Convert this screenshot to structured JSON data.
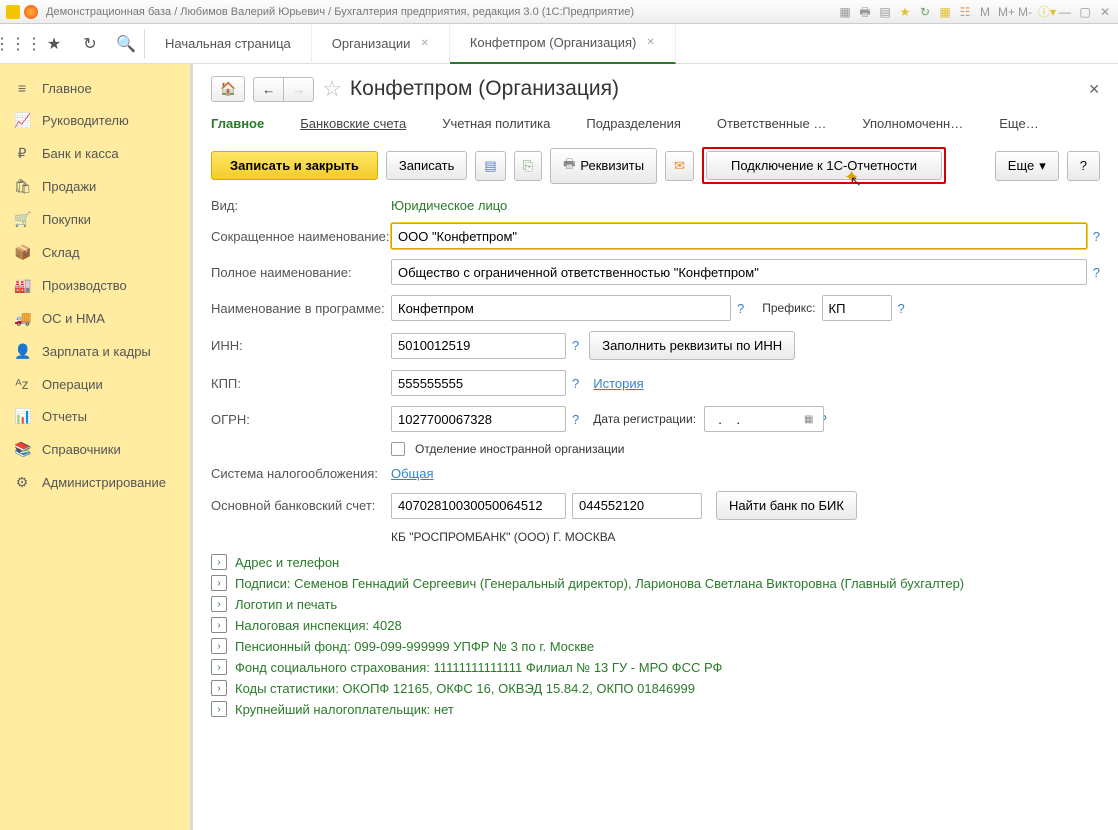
{
  "window": {
    "title": "Демонстрационная база / Любимов Валерий Юрьевич / Бухгалтерия предприятия, редакция 3.0  (1С:Предприятие)"
  },
  "tabs": [
    {
      "label": "Начальная страница",
      "closable": false,
      "active": false
    },
    {
      "label": "Организации",
      "closable": true,
      "active": false
    },
    {
      "label": "Конфетпром (Организация)",
      "closable": true,
      "active": true
    }
  ],
  "sidebar": [
    {
      "icon": "≡",
      "label": "Главное"
    },
    {
      "icon": "📈",
      "label": "Руководителю"
    },
    {
      "icon": "₽",
      "label": "Банк и касса"
    },
    {
      "icon": "🛍",
      "label": "Продажи"
    },
    {
      "icon": "🛒",
      "label": "Покупки"
    },
    {
      "icon": "📦",
      "label": "Склад"
    },
    {
      "icon": "🏭",
      "label": "Производство"
    },
    {
      "icon": "🚚",
      "label": "ОС и НМА"
    },
    {
      "icon": "👤",
      "label": "Зарплата и кадры"
    },
    {
      "icon": "ᴬz",
      "label": "Операции"
    },
    {
      "icon": "📊",
      "label": "Отчеты"
    },
    {
      "icon": "📚",
      "label": "Справочники"
    },
    {
      "icon": "⚙",
      "label": "Администрирование"
    }
  ],
  "page": {
    "title": "Конфетпром (Организация)",
    "subtabs": [
      "Главное",
      "Банковские счета",
      "Учетная политика",
      "Подразделения",
      "Ответственные …",
      "Уполномоченн…",
      "Еще…"
    ]
  },
  "buttons": {
    "save_close": "Записать и закрыть",
    "save": "Записать",
    "requisites": "Реквизиты",
    "connect1c": "Подключение к 1С-Отчетности",
    "more": "Еще",
    "help": "?",
    "fill_inn": "Заполнить реквизиты по ИНН",
    "history": "История",
    "find_bank": "Найти банк по БИК"
  },
  "labels": {
    "type": "Вид:",
    "short_name": "Сокращенное наименование:",
    "full_name": "Полное наименование:",
    "prog_name": "Наименование в программе:",
    "prefix": "Префикс:",
    "inn": "ИНН:",
    "kpp": "КПП:",
    "ogrn": "ОГРН:",
    "reg_date": "Дата регистрации:",
    "foreign": "Отделение иностранной организации",
    "tax_system": "Система налогообложения:",
    "bank_acc": "Основной банковский счет:"
  },
  "values": {
    "type": "Юридическое лицо",
    "short_name": "ООО \"Конфетпром\"",
    "full_name": "Общество с ограниченной ответственностью \"Конфетпром\"",
    "prog_name": "Конфетпром",
    "prefix": "КП",
    "inn": "5010012519",
    "kpp": "555555555",
    "ogrn": "1027700067328",
    "reg_date": "  .    .",
    "tax_system": "Общая",
    "bank_acc": "40702810030050064512",
    "bik": "044552120",
    "bank_name": "КБ \"РОСПРОМБАНК\" (ООО) Г. МОСКВА"
  },
  "expandables": [
    "Адрес и телефон",
    "Подписи: Семенов Геннадий Сергеевич (Генеральный директор), Ларионова Светлана Викторовна (Главный бухгалтер)",
    "Логотип и печать",
    "Налоговая инспекция: 4028",
    "Пенсионный фонд: 099-099-999999 УПФР № 3 по г. Москве",
    "Фонд социального страхования: 11111111111111 Филиал № 13 ГУ - МРО ФСС РФ",
    "Коды статистики: ОКОПФ 12165, ОКФС 16, ОКВЭД 15.84.2, ОКПО 01846999",
    "Крупнейший налогоплательщик: нет"
  ]
}
